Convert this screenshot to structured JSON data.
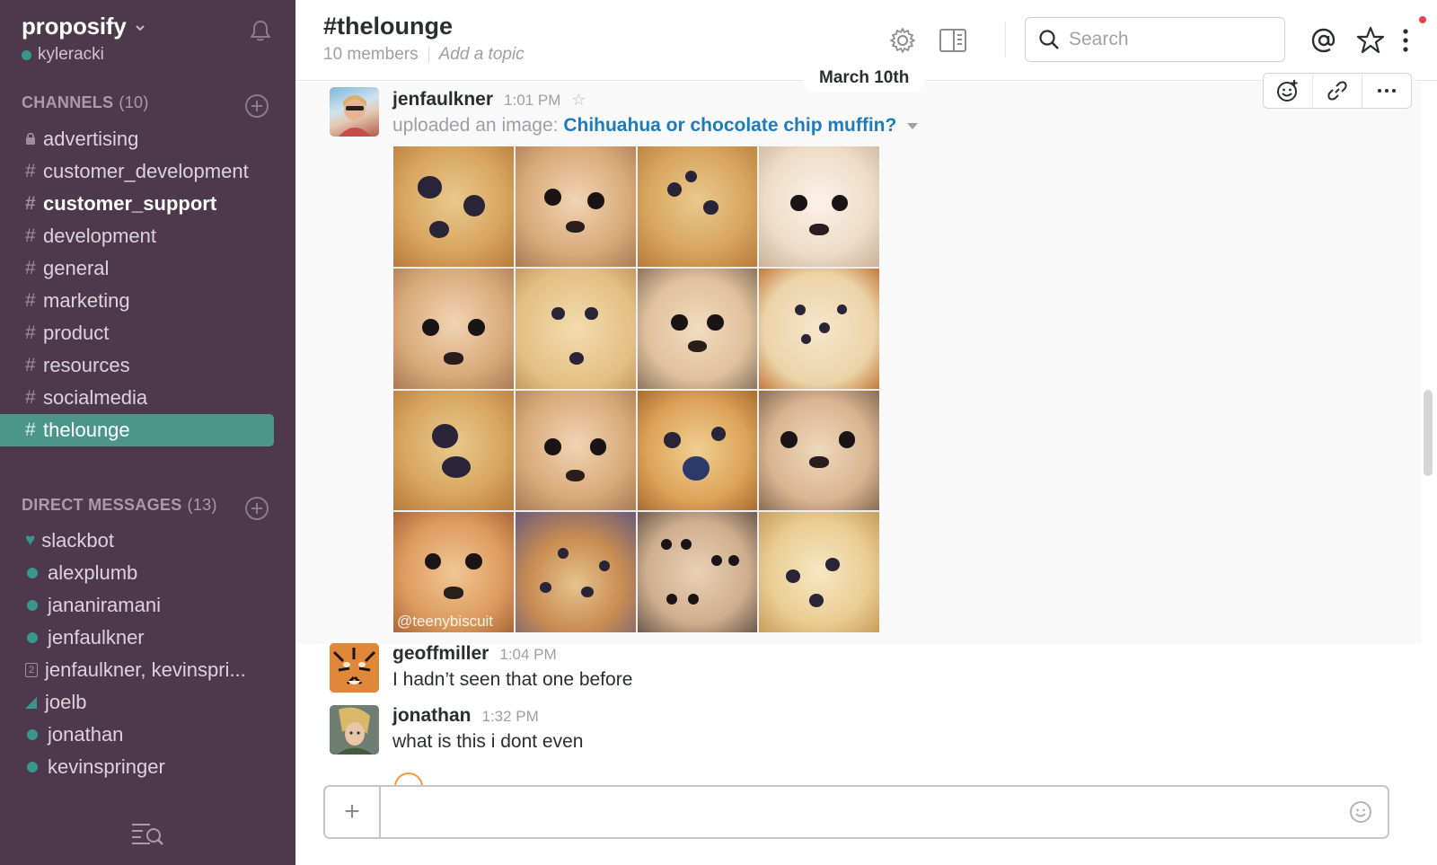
{
  "team": {
    "name": "proposify",
    "user": "kyleracki"
  },
  "sidebar": {
    "channels_header": "CHANNELS",
    "channels_count": "(10)",
    "channels": [
      {
        "prefix": "",
        "name": "advertising",
        "private": true
      },
      {
        "prefix": "#",
        "name": "customer_development"
      },
      {
        "prefix": "#",
        "name": "customer_support",
        "unread": true
      },
      {
        "prefix": "#",
        "name": "development"
      },
      {
        "prefix": "#",
        "name": "general"
      },
      {
        "prefix": "#",
        "name": "marketing"
      },
      {
        "prefix": "#",
        "name": "product"
      },
      {
        "prefix": "#",
        "name": "resources"
      },
      {
        "prefix": "#",
        "name": "socialmedia"
      },
      {
        "prefix": "#",
        "name": "thelounge",
        "active": true
      }
    ],
    "dm_header": "DIRECT MESSAGES",
    "dm_count": "(13)",
    "dms": [
      {
        "name": "slackbot",
        "status": "heart"
      },
      {
        "name": "alexplumb",
        "status": "online"
      },
      {
        "name": "jananiramani",
        "status": "online"
      },
      {
        "name": "jenfaulkner",
        "status": "online"
      },
      {
        "name": "jenfaulkner, kevinspri...",
        "status": "group",
        "group_count": "2"
      },
      {
        "name": "joelb",
        "status": "triangle"
      },
      {
        "name": "jonathan",
        "status": "online"
      },
      {
        "name": "kevinspringer",
        "status": "online"
      }
    ]
  },
  "header": {
    "channel": "#thelounge",
    "members": "10 members",
    "topic": "Add a topic",
    "search_placeholder": "Search"
  },
  "date_divider": "March 10th",
  "messages": [
    {
      "author": "jenfaulkner",
      "time": "1:01 PM",
      "upload_prefix": "uploaded an image:",
      "upload_title": "Chihuahua or chocolate chip muffin?",
      "watermark": "@teenybiscuit"
    },
    {
      "author": "geoffmiller",
      "time": "1:04 PM",
      "text": "I hadn’t seen that one before"
    },
    {
      "author": "jonathan",
      "time": "1:32 PM",
      "text": "what is this i dont even"
    }
  ],
  "colors": {
    "sidebar_bg": "#4d394b",
    "active_channel": "#4c9689",
    "link": "#1d7bb8",
    "online": "#38978d",
    "notification": "#e8404a"
  }
}
